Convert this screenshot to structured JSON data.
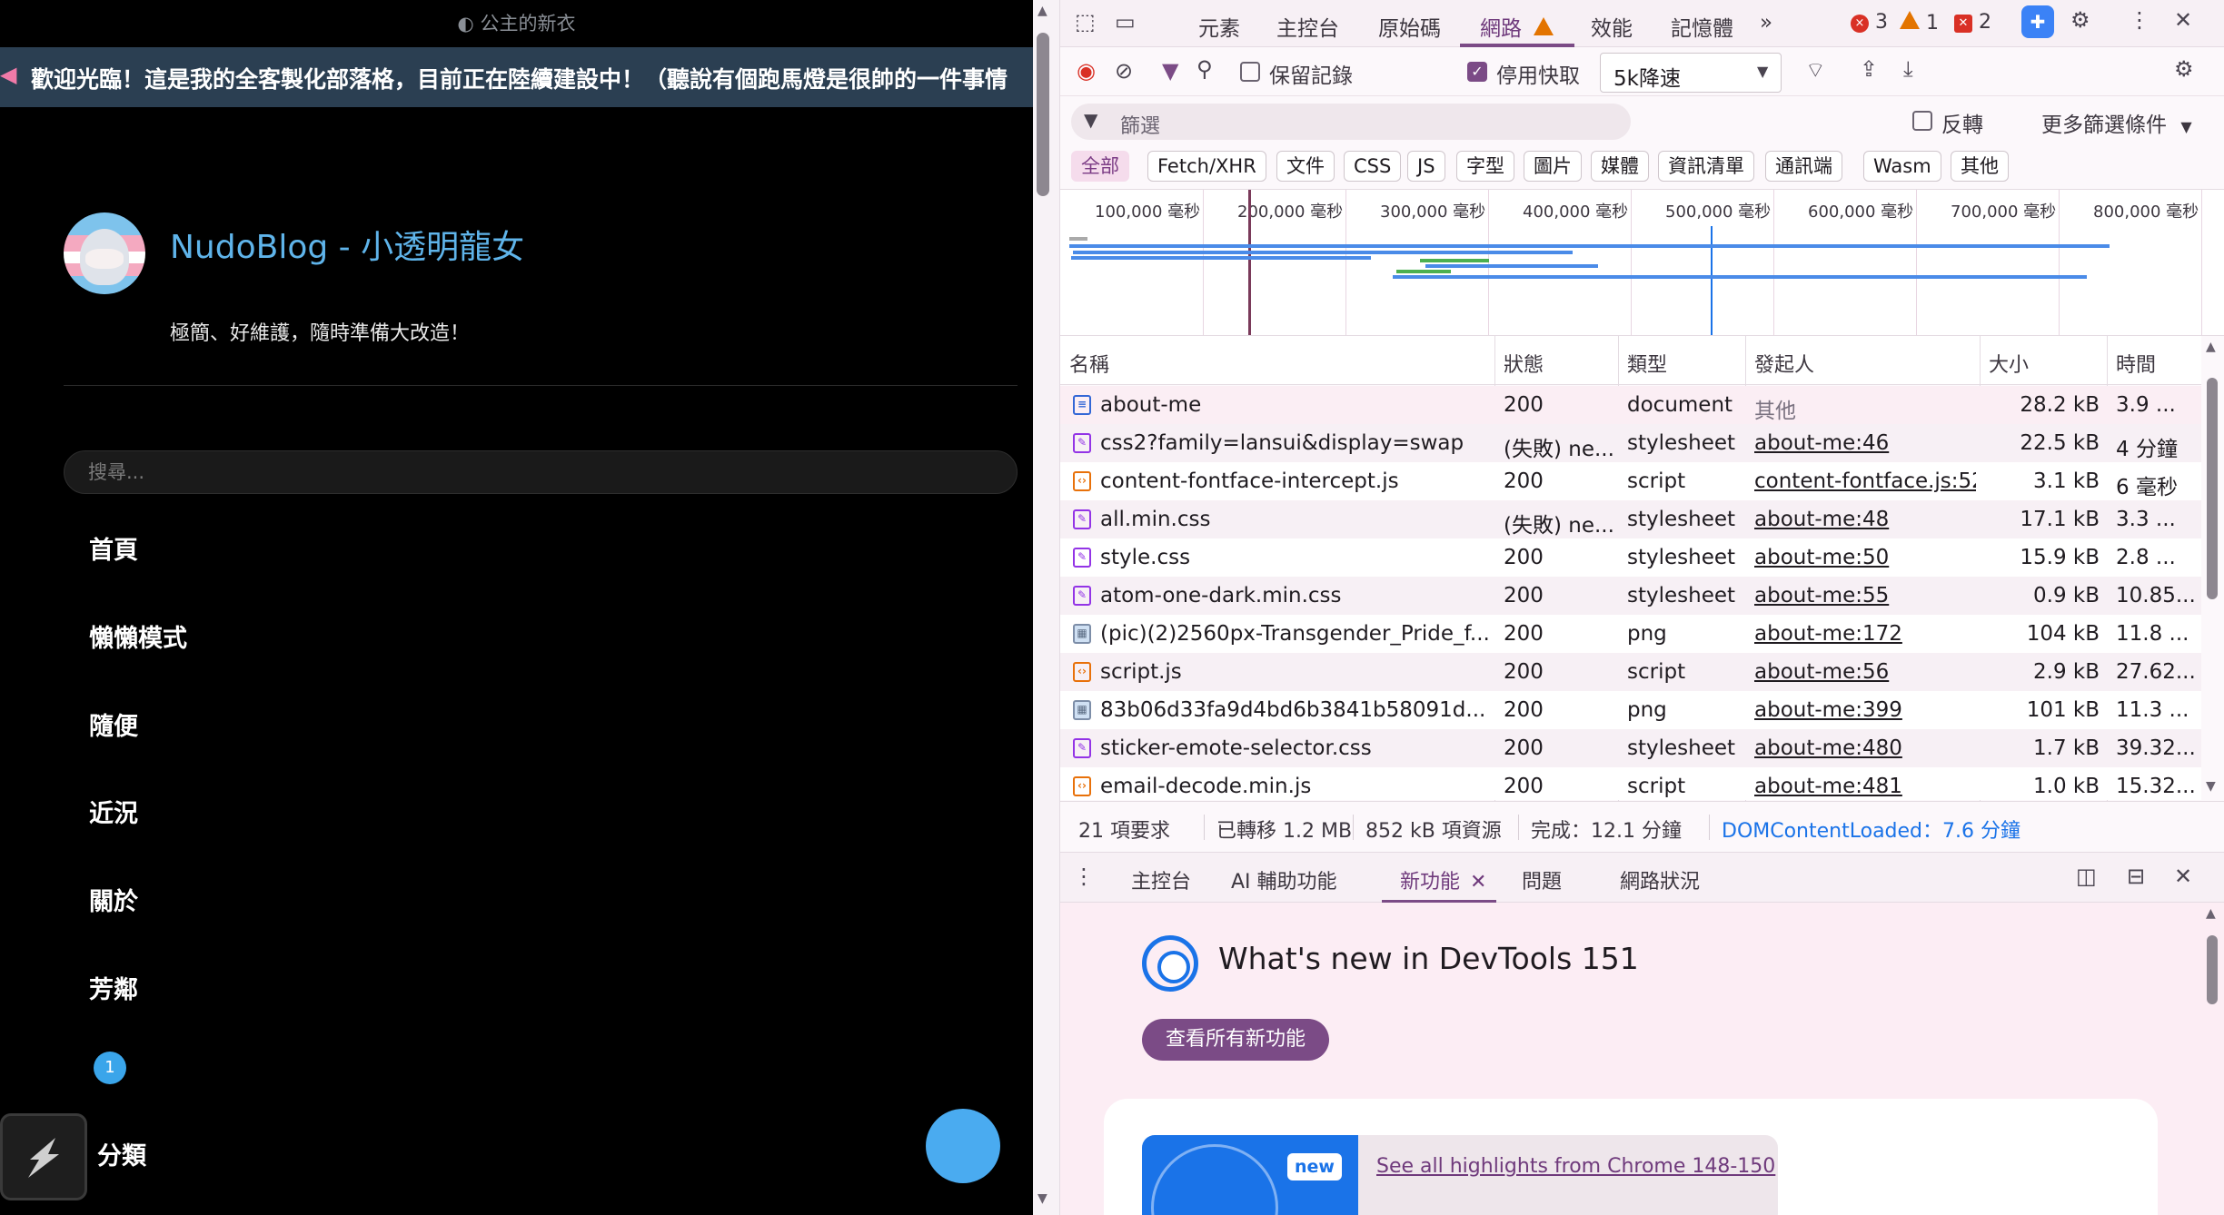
{
  "blog": {
    "top_note": "◐ 公主的新衣",
    "marquee_text": "歡迎光臨！這是我的全客製化部落格，目前正在陸續建設中！（聽說有個跑馬燈是很帥的一件事情",
    "site_title": "NudoBlog - 小透明龍女",
    "tagline": "極簡、好維護，隨時準備大改造！",
    "search_placeholder": "搜尋...",
    "nav": [
      "首頁",
      "懶懶模式",
      "隨便",
      "近況",
      "關於",
      "芳鄰"
    ],
    "badge_count": "1",
    "category_label": "分類"
  },
  "devtools": {
    "tabs": [
      "元素",
      "主控台",
      "原始碼",
      "網路",
      "效能",
      "記憶體"
    ],
    "active_tab": "網路",
    "more_tabs": "»",
    "errors": "3",
    "warnings": "1",
    "issues": "2",
    "toolbar": {
      "preserve_log": "保留記錄",
      "disable_cache": "停用快取",
      "throttle": "5k降速"
    },
    "filter": {
      "placeholder": "篩選",
      "invert": "反轉",
      "more_filters": "更多篩選條件"
    },
    "type_filters": [
      "全部",
      "Fetch/XHR",
      "文件",
      "CSS",
      "JS",
      "字型",
      "圖片",
      "媒體",
      "資訊清單",
      "通訊端",
      "Wasm",
      "其他"
    ],
    "timeline_ticks": [
      "100,000 毫秒",
      "200,000 毫秒",
      "300,000 毫秒",
      "400,000 毫秒",
      "500,000 毫秒",
      "600,000 毫秒",
      "700,000 毫秒",
      "800,000 毫秒"
    ],
    "columns": {
      "name": "名稱",
      "status": "狀態",
      "type": "類型",
      "initiator": "發起人",
      "size": "大小",
      "time": "時間"
    },
    "requests": [
      {
        "icon": "doc",
        "name": "about-me",
        "status": "200",
        "type": "document",
        "initiator": "其他",
        "size": "28.2 kB",
        "time": "3.9 ..."
      },
      {
        "icon": "css",
        "name": "css2?family=lansui&display=swap",
        "status": "(失敗) ne...",
        "type": "stylesheet",
        "initiator": "about-me:46",
        "size": "22.5 kB",
        "time": "4 分鐘"
      },
      {
        "icon": "js",
        "name": "content-fontface-intercept.js",
        "status": "200",
        "type": "script",
        "initiator": "content-fontface.js:52",
        "size": "3.1 kB",
        "time": "6 毫秒"
      },
      {
        "icon": "css",
        "name": "all.min.css",
        "status": "(失敗) ne...",
        "type": "stylesheet",
        "initiator": "about-me:48",
        "size": "17.1 kB",
        "time": "3.3 ..."
      },
      {
        "icon": "css",
        "name": "style.css",
        "status": "200",
        "type": "stylesheet",
        "initiator": "about-me:50",
        "size": "15.9 kB",
        "time": "2.8 ..."
      },
      {
        "icon": "css",
        "name": "atom-one-dark.min.css",
        "status": "200",
        "type": "stylesheet",
        "initiator": "about-me:55",
        "size": "0.9 kB",
        "time": "10.85..."
      },
      {
        "icon": "img",
        "name": "(pic)(2)2560px-Transgender_Pride_f...",
        "status": "200",
        "type": "png",
        "initiator": "about-me:172",
        "size": "104 kB",
        "time": "11.8 ..."
      },
      {
        "icon": "js",
        "name": "script.js",
        "status": "200",
        "type": "script",
        "initiator": "about-me:56",
        "size": "2.9 kB",
        "time": "27.62..."
      },
      {
        "icon": "img",
        "name": "83b06d33fa9d4bd6b3841b58091d...",
        "status": "200",
        "type": "png",
        "initiator": "about-me:399",
        "size": "101 kB",
        "time": "11.3 ..."
      },
      {
        "icon": "css",
        "name": "sticker-emote-selector.css",
        "status": "200",
        "type": "stylesheet",
        "initiator": "about-me:480",
        "size": "1.7 kB",
        "time": "39.32..."
      },
      {
        "icon": "js",
        "name": "email-decode.min.js",
        "status": "200",
        "type": "script",
        "initiator": "about-me:481",
        "size": "1.0 kB",
        "time": "15.32..."
      }
    ],
    "summary": {
      "requests": "21 項要求",
      "transferred": "已轉移 1.2 MB",
      "resources": "852 kB 項資源",
      "finish": "完成：12.1 分鐘",
      "dcl": "DOMContentLoaded：7.6 分鐘"
    },
    "drawer_tabs": [
      "主控台",
      "AI 輔助功能",
      "新功能",
      "問題",
      "網路狀況"
    ],
    "active_drawer_tab": "新功能",
    "whats_new": {
      "title": "What's new in DevTools 151",
      "button": "查看所有新功能",
      "new_badge": "new",
      "highlight_link": "See all highlights from Chrome 148-150"
    }
  },
  "colors": {
    "accent": "#7b4b86",
    "link_blue": "#1a73e8",
    "blog_title": "#5fb4ea",
    "marquee_bg": "#2b3f52"
  }
}
